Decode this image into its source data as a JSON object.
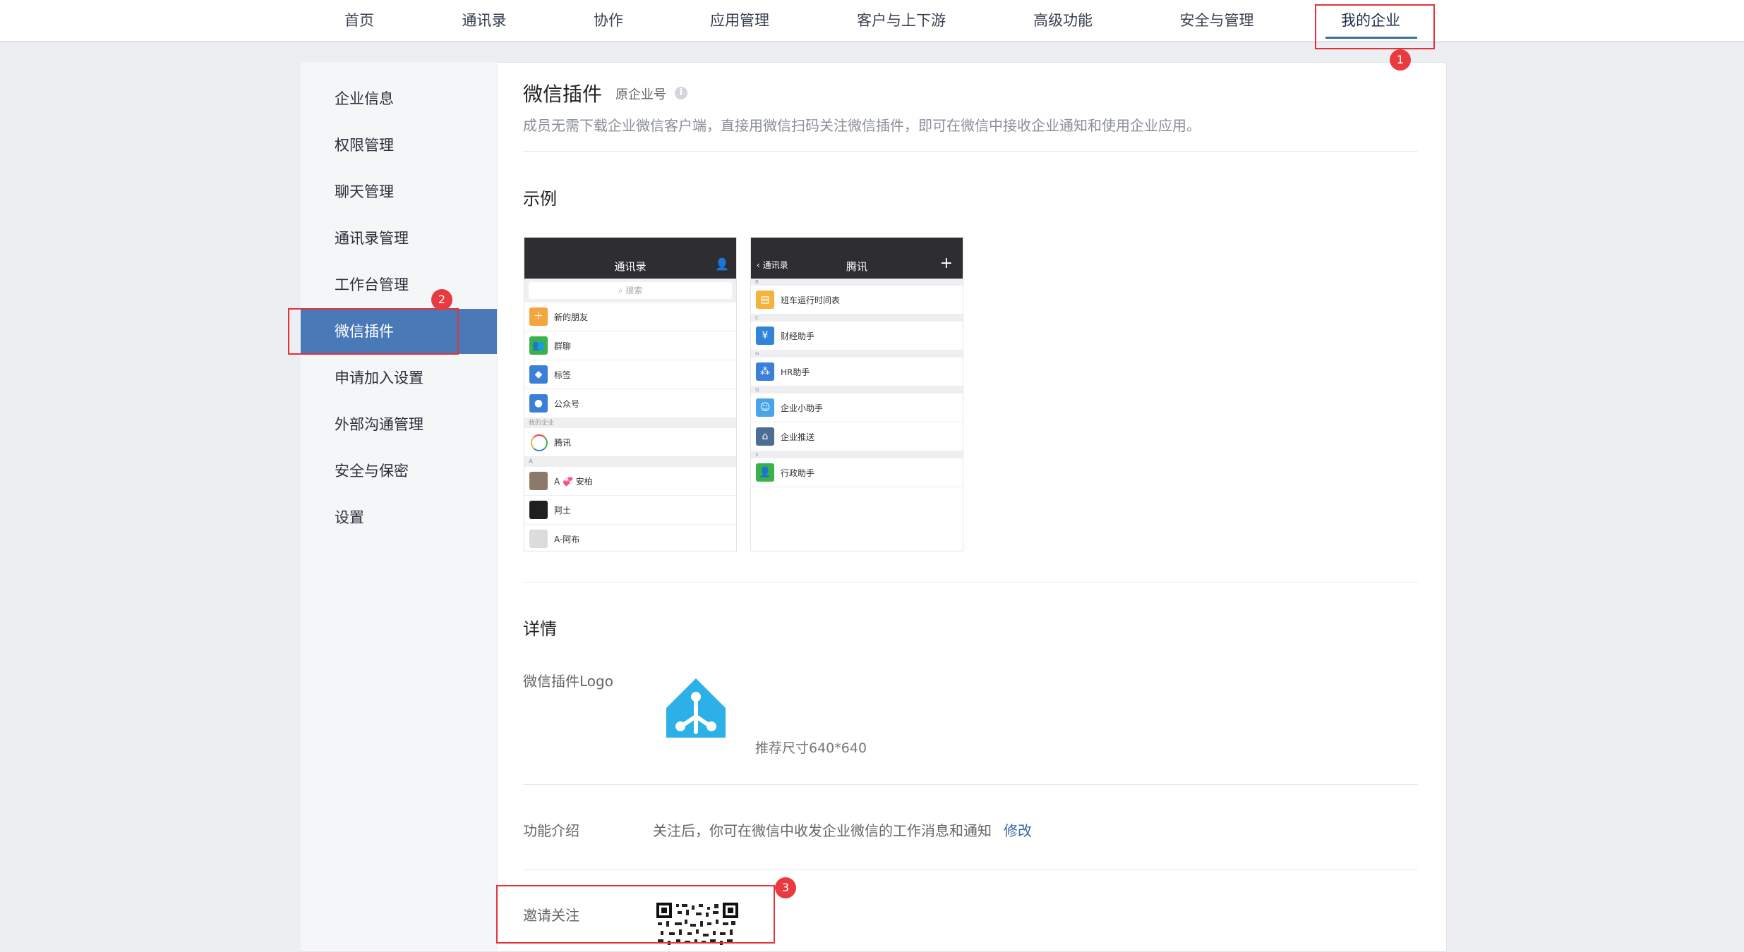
{
  "topnav": {
    "items": [
      {
        "label": "首页",
        "active": false
      },
      {
        "label": "通讯录",
        "active": false
      },
      {
        "label": "协作",
        "active": false
      },
      {
        "label": "应用管理",
        "active": false
      },
      {
        "label": "客户与上下游",
        "active": false
      },
      {
        "label": "高级功能",
        "active": false
      },
      {
        "label": "安全与管理",
        "active": false
      },
      {
        "label": "我的企业",
        "active": true
      }
    ]
  },
  "annotations": {
    "badge1": "1",
    "badge2": "2",
    "badge3": "3",
    "highlight_color": "#e4323a"
  },
  "sidebar": {
    "items": [
      {
        "label": "企业信息",
        "active": false
      },
      {
        "label": "权限管理",
        "active": false
      },
      {
        "label": "聊天管理",
        "active": false
      },
      {
        "label": "通讯录管理",
        "active": false
      },
      {
        "label": "工作台管理",
        "active": false
      },
      {
        "label": "微信插件",
        "active": true
      },
      {
        "label": "申请加入设置",
        "active": false
      },
      {
        "label": "外部沟通管理",
        "active": false
      },
      {
        "label": "安全与保密",
        "active": false
      },
      {
        "label": "设置",
        "active": false
      }
    ],
    "active_color": "#4a79b7"
  },
  "main": {
    "title": "微信插件",
    "subtitle": "原企业号",
    "info_icon": "i",
    "description": "成员无需下载企业微信客户端，直接用微信扫码关注微信插件，即可在微信中接收企业通知和使用企业应用。",
    "example_title": "示例",
    "details_title": "详情",
    "logo_label": "微信插件Logo",
    "logo_hint": "推荐尺寸640*640",
    "feature_label": "功能介绍",
    "feature_text": "关注后，你可在微信中收发企业微信的工作消息和通知",
    "feature_edit": "修改",
    "invite_label": "邀请关注"
  },
  "phone_left": {
    "title": "通讯录",
    "search_placeholder": "搜索",
    "rows": [
      {
        "icon": "person-add-icon",
        "label": "新的朋友",
        "color": "#f5a53d"
      },
      {
        "icon": "group-icon",
        "label": "群聊",
        "color": "#3ab14a"
      },
      {
        "icon": "tag-icon",
        "label": "标签",
        "color": "#3a7fd8"
      },
      {
        "icon": "official-account-icon",
        "label": "公众号",
        "color": "#3a7fd8"
      }
    ],
    "section_company": "我的企业",
    "company_row": "腾讯",
    "section_a": "A",
    "contacts": [
      "A 💞 安柏",
      "阿土",
      "A-阿布"
    ]
  },
  "phone_right": {
    "back_label": "通讯录",
    "title": "腾讯",
    "sections": [
      "B",
      "C",
      "H",
      "Q",
      "X"
    ],
    "rows": [
      {
        "icon": "schedule-icon",
        "label": "班车运行时间表",
        "color": "#f3b33d"
      },
      {
        "icon": "yen-icon",
        "label": "财经助手",
        "color": "#2f86d8"
      },
      {
        "icon": "hr-icon",
        "label": "HR助手",
        "color": "#3a7fd8"
      },
      {
        "icon": "assistant-icon",
        "label": "企业小助手",
        "color": "#49a4e8"
      },
      {
        "icon": "home-icon",
        "label": "企业推送",
        "color": "#4d6d93"
      },
      {
        "icon": "admin-icon",
        "label": "行政助手",
        "color": "#3ab14a"
      }
    ]
  }
}
